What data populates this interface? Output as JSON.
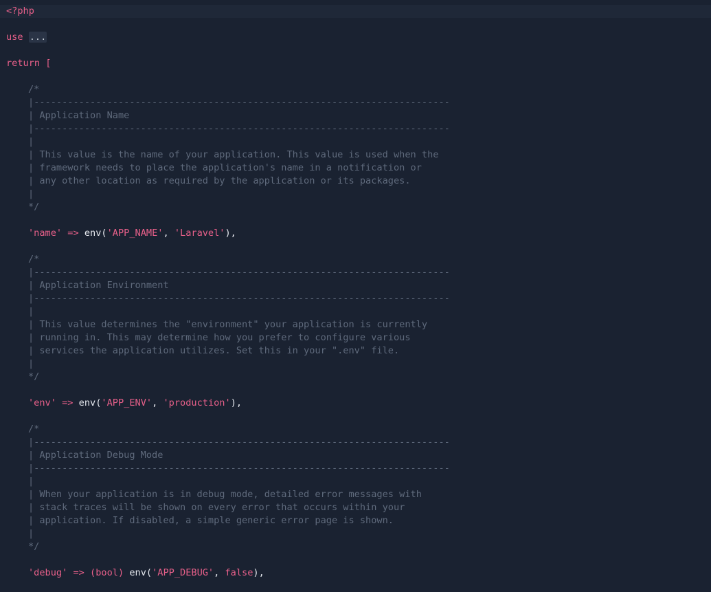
{
  "editor": {
    "language": "php",
    "colors": {
      "background": "#1a2231",
      "keyword": "#e8608a",
      "comment": "#5f6a7c",
      "text": "#e6e9ef"
    },
    "open_tag": "<?php",
    "use_keyword": "use",
    "use_folded": "...",
    "return_keyword": "return",
    "open_bracket": "[",
    "blocks": [
      {
        "comment_open": "/*",
        "rule": "|--------------------------------------------------------------------------",
        "heading": "| Application Name",
        "blank": "|",
        "lines": [
          "| This value is the name of your application. This value is used when the",
          "| framework needs to place the application's name in a notification or",
          "| any other location as required by the application or its packages."
        ],
        "comment_close": "*/",
        "key": "'name'",
        "arrow": "=>",
        "cast": "",
        "fn": "env(",
        "arg1": "'APP_NAME'",
        "comma": ", ",
        "arg2": "'Laravel'",
        "close": "),"
      },
      {
        "comment_open": "/*",
        "rule": "|--------------------------------------------------------------------------",
        "heading": "| Application Environment",
        "blank": "|",
        "lines": [
          "| This value determines the \"environment\" your application is currently",
          "| running in. This may determine how you prefer to configure various",
          "| services the application utilizes. Set this in your \".env\" file."
        ],
        "comment_close": "*/",
        "key": "'env'",
        "arrow": "=>",
        "cast": "",
        "fn": "env(",
        "arg1": "'APP_ENV'",
        "comma": ", ",
        "arg2": "'production'",
        "close": "),"
      },
      {
        "comment_open": "/*",
        "rule": "|--------------------------------------------------------------------------",
        "heading": "| Application Debug Mode",
        "blank": "|",
        "lines": [
          "| When your application is in debug mode, detailed error messages with",
          "| stack traces will be shown on every error that occurs within your",
          "| application. If disabled, a simple generic error page is shown."
        ],
        "comment_close": "*/",
        "key": "'debug'",
        "arrow": "=>",
        "cast": "(bool)",
        "fn": "env(",
        "arg1": "'APP_DEBUG'",
        "comma": ", ",
        "arg2": "false",
        "close": "),"
      }
    ]
  }
}
